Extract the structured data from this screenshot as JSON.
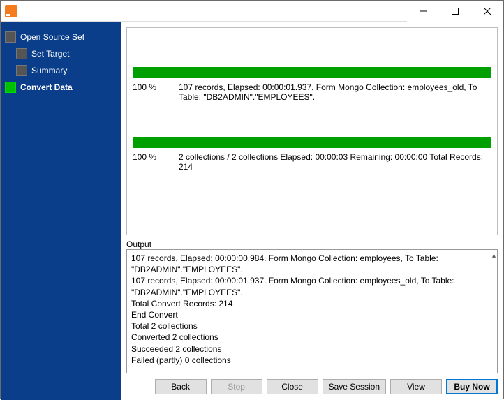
{
  "titlebar": {
    "title": ""
  },
  "sidebar": {
    "items": [
      {
        "label": "Open Source Set",
        "active": false
      },
      {
        "label": "Set Target",
        "active": false
      },
      {
        "label": "Summary",
        "active": false
      },
      {
        "label": "Convert Data",
        "active": true
      }
    ]
  },
  "progress": [
    {
      "percent": "100 %",
      "detail": "107 records,    Elapsed: 00:00:01.937.    Form Mongo Collection: employees_old,    To Table: \"DB2ADMIN\".\"EMPLOYEES\"."
    },
    {
      "percent": "100 %",
      "detail": "2 collections / 2 collections    Elapsed: 00:00:03    Remaining: 00:00:00    Total Records: 214"
    }
  ],
  "output_label": "Output",
  "output_lines": [
    "107 records,    Elapsed: 00:00:00.984.    Form Mongo Collection: employees,    To Table: \"DB2ADMIN\".\"EMPLOYEES\".",
    "107 records,    Elapsed: 00:00:01.937.    Form Mongo Collection: employees_old,    To Table: \"DB2ADMIN\".\"EMPLOYEES\".",
    "Total Convert Records: 214",
    "End Convert",
    "Total 2 collections",
    "Converted 2 collections",
    "Succeeded 2 collections",
    "Failed (partly) 0 collections"
  ],
  "buttons": {
    "back": "Back",
    "stop": "Stop",
    "close": "Close",
    "save_session": "Save Session",
    "view": "View",
    "buy_now": "Buy Now"
  },
  "colors": {
    "sidebar_bg": "#0a3d8a",
    "progress_fill": "#00a000",
    "primary_border": "#0078d7"
  }
}
